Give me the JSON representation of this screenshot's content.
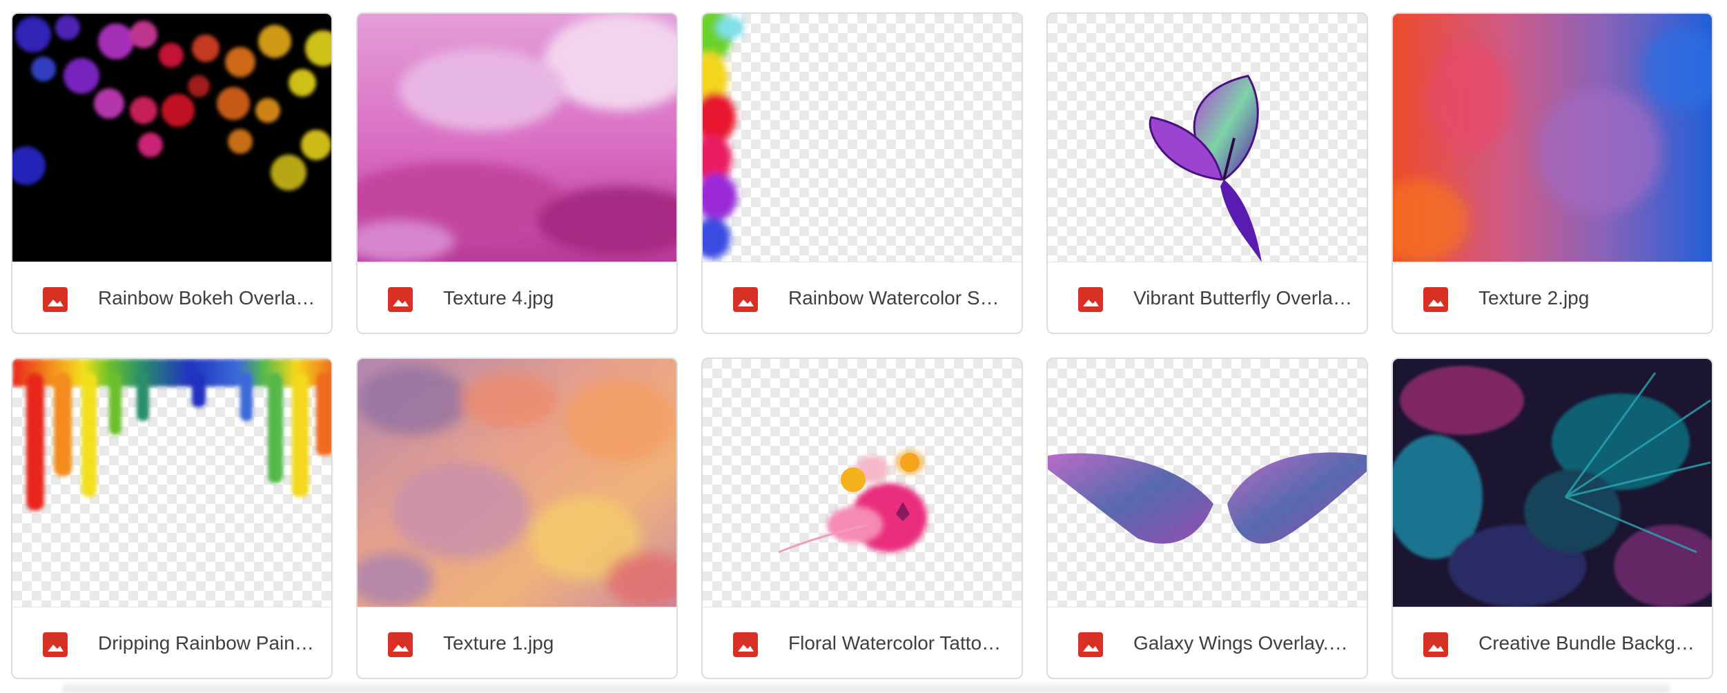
{
  "grid": {
    "items": [
      {
        "name": "Rainbow Bokeh Overlay.png",
        "icon": "image-file-icon"
      },
      {
        "name": "Texture 4.jpg",
        "icon": "image-file-icon"
      },
      {
        "name": "Rainbow Watercolor Splash.png",
        "icon": "image-file-icon"
      },
      {
        "name": "Vibrant Butterfly Overlay.png",
        "icon": "image-file-icon"
      },
      {
        "name": "Texture 2.jpg",
        "icon": "image-file-icon"
      },
      {
        "name": "Dripping Rainbow Paint.png",
        "icon": "image-file-icon"
      },
      {
        "name": "Texture 1.jpg",
        "icon": "image-file-icon"
      },
      {
        "name": "Floral Watercolor Tattoo.png",
        "icon": "image-file-icon"
      },
      {
        "name": "Galaxy Wings Overlay.png",
        "icon": "image-file-icon"
      },
      {
        "name": "Creative Bundle Background.jpg",
        "icon": "image-file-icon"
      }
    ]
  },
  "colors": {
    "icon_red": "#d93025",
    "text": "#3c4043",
    "border": "#dadce0"
  }
}
